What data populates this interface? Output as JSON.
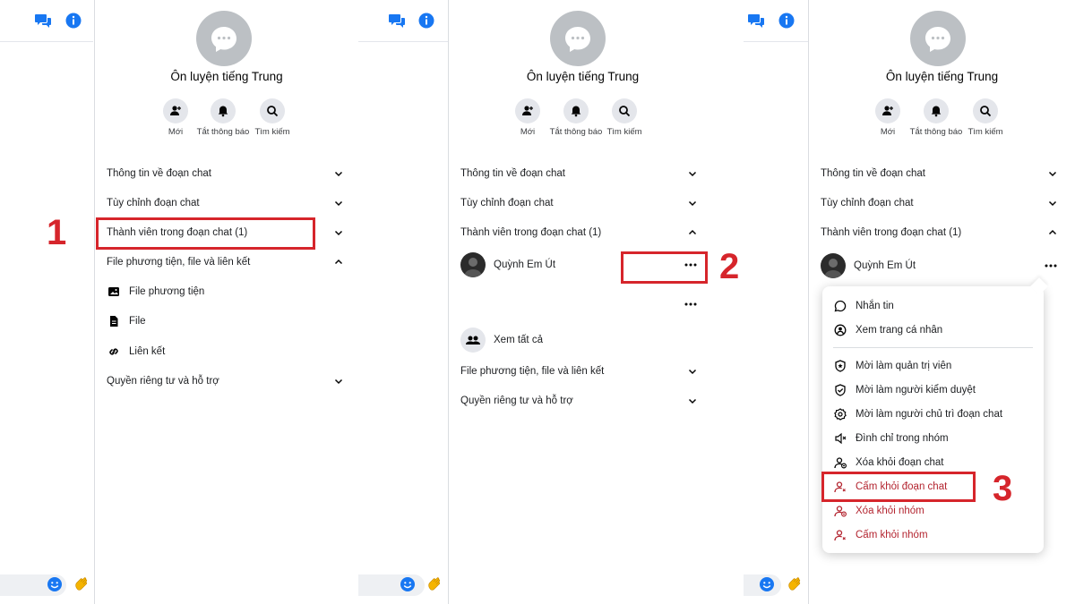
{
  "colors": {
    "accent": "#1877f2",
    "highlight": "#d6252b",
    "danger_text": "#b3242f",
    "chip_bg": "#e4e6eb"
  },
  "group": {
    "name": "Ôn luyện tiếng Trung"
  },
  "quick_actions": {
    "add": "Mới",
    "mute": "Tắt thông báo",
    "search": "Tìm kiếm"
  },
  "sections": {
    "chat_info": "Thông tin về đoạn chat",
    "customize": "Tùy chỉnh đoạn chat",
    "members": "Thành viên trong đoạn chat (1)",
    "media": "File phương tiện, file và liên kết",
    "privacy": "Quyền riêng tư và hỗ trợ"
  },
  "media_items": {
    "media": "File phương tiện",
    "file": "File",
    "links": "Liên kết"
  },
  "member": {
    "name": "Quỳnh Em Út",
    "see_all": "Xem tất cả"
  },
  "member_menu": {
    "message": "Nhắn tin",
    "view_profile": "Xem trang cá nhân",
    "make_admin": "Mời làm quản trị viên",
    "make_moderator": "Mời làm người kiểm duyệt",
    "make_owner": "Mời làm người chủ trì đoạn chat",
    "mute_in_group": "Đình chỉ trong nhóm",
    "remove_from_chat": "Xóa khỏi đoạn chat",
    "ban_from_chat": "Cấm khỏi đoạn chat",
    "remove_from_group": "Xóa khỏi nhóm",
    "ban_from_group": "Cấm khỏi nhóm"
  },
  "steps": {
    "one": "1",
    "two": "2",
    "three": "3"
  }
}
